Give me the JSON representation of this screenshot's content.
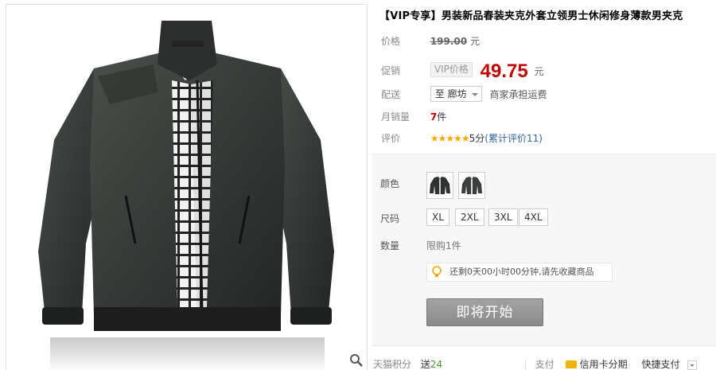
{
  "product": {
    "title": "【VIP专享】男装新品春装夹克外套立领男士休闲修身薄款男夹克",
    "image_alt": "jacket-product-image"
  },
  "price": {
    "label": "价格",
    "original": "199.00",
    "currency": "元"
  },
  "promo": {
    "label": "促销",
    "tag": "VIP价格",
    "price": "49.75",
    "currency": "元"
  },
  "shipping": {
    "label": "配送",
    "destination": "至 廊坊",
    "note": "商家承担运费"
  },
  "sales": {
    "label": "月销量",
    "count": "7",
    "unit": "件"
  },
  "rating": {
    "label": "评价",
    "stars": "★★★★★",
    "score": "5分",
    "open_paren": "(",
    "reviews_link": "累计评价11",
    "close_paren": ")"
  },
  "options": {
    "color_label": "颜色",
    "size_label": "尺码",
    "sizes": [
      "XL",
      "2XL",
      "3XL",
      "4XL"
    ],
    "qty_label": "数量",
    "qty_limit": "限购1件",
    "tip": "还剩0天00小时00分钟,请先收藏商品",
    "start_button": "即将开始"
  },
  "bottom": {
    "points_label": "天猫积分",
    "points_prefix": "送",
    "points_value": "24",
    "pay_label": "支付",
    "card_pay": "信用卡分期",
    "quick_pay": "快捷支付"
  },
  "colors": {
    "price_red": "#c40000",
    "star_gold": "#f5a800",
    "link_blue": "#3366aa",
    "button_gray": "#909090",
    "jacket": "#3a3f3c"
  }
}
